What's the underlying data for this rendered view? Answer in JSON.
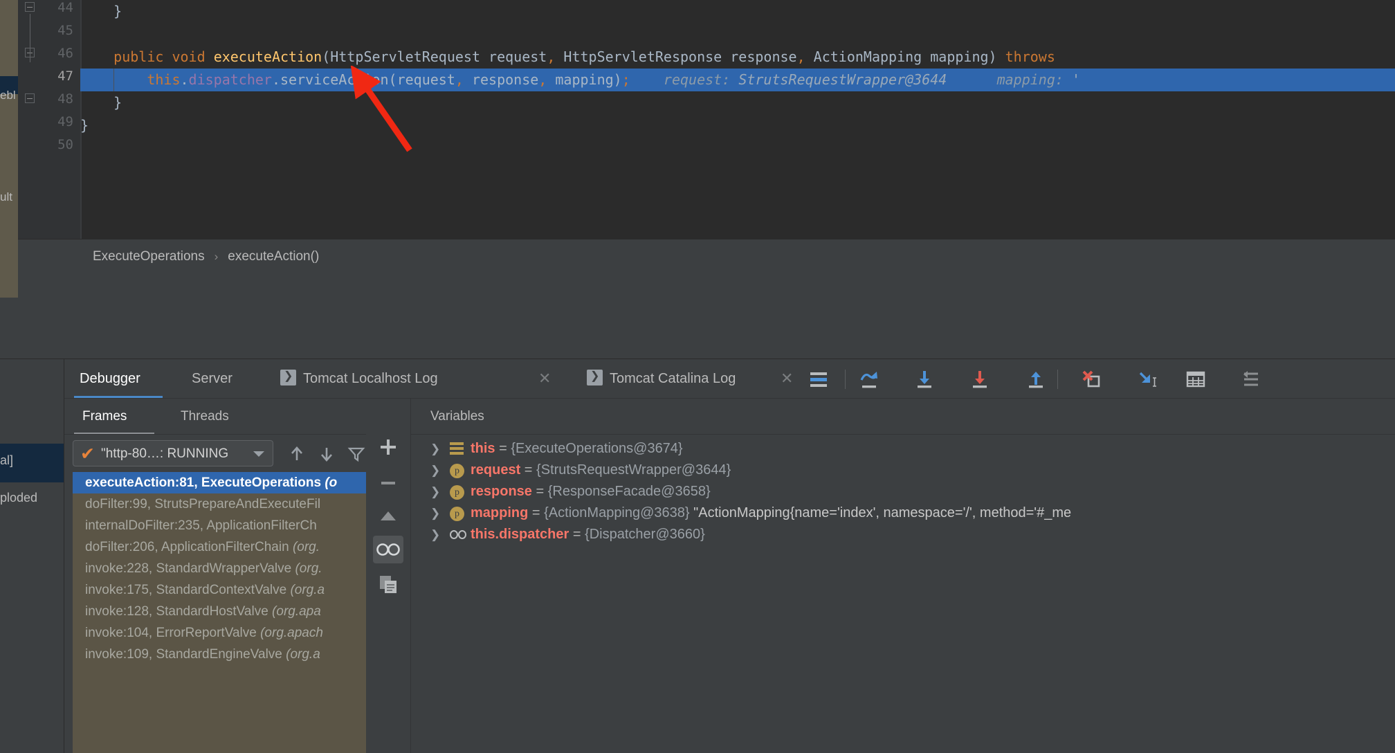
{
  "editor": {
    "gutter": {
      "line_numbers": [
        "44",
        "45",
        "46",
        "47",
        "48",
        "49",
        "50"
      ],
      "current_line": "47"
    },
    "code_lines": [
      {
        "num": "44",
        "segments": [
          {
            "t": "    }",
            "c": "pln"
          }
        ]
      },
      {
        "num": "45",
        "segments": []
      },
      {
        "num": "46",
        "segments": [
          {
            "t": "    ",
            "c": "pln"
          },
          {
            "t": "public",
            "c": "kw"
          },
          {
            "t": " ",
            "c": "pln"
          },
          {
            "t": "void",
            "c": "kw"
          },
          {
            "t": " ",
            "c": "pln"
          },
          {
            "t": "executeAction",
            "c": "mth"
          },
          {
            "t": "(HttpServletRequest request",
            "c": "pln"
          },
          {
            "t": ",",
            "c": "comma"
          },
          {
            "t": " HttpServletResponse response",
            "c": "pln"
          },
          {
            "t": ",",
            "c": "comma"
          },
          {
            "t": " ActionMapping mapping) ",
            "c": "pln"
          },
          {
            "t": "throws",
            "c": "kw"
          }
        ]
      },
      {
        "num": "47",
        "segments": [
          {
            "t": "        ",
            "c": "pln"
          },
          {
            "t": "this",
            "c": "kw"
          },
          {
            "t": ".",
            "c": "pln"
          },
          {
            "t": "dispatcher",
            "c": "fld"
          },
          {
            "t": ".serviceAction(request",
            "c": "pln"
          },
          {
            "t": ",",
            "c": "comma"
          },
          {
            "t": " response",
            "c": "pln"
          },
          {
            "t": ",",
            "c": "comma"
          },
          {
            "t": " mapping)",
            "c": "pln"
          },
          {
            "t": ";",
            "c": "comma"
          },
          {
            "t": "    request: ",
            "c": "hint"
          },
          {
            "t": "StrutsRequestWrapper@3644",
            "c": "hintv"
          },
          {
            "t": "      mapping: ",
            "c": "hint"
          },
          {
            "t": "'",
            "c": "hintv"
          }
        ]
      },
      {
        "num": "48",
        "segments": [
          {
            "t": "    }",
            "c": "pln"
          }
        ]
      },
      {
        "num": "49",
        "segments": [
          {
            "t": "}",
            "c": "pln"
          }
        ]
      },
      {
        "num": "50",
        "segments": []
      }
    ],
    "left_strip_labels": {
      "top": "ebl",
      "bottom": "ult"
    },
    "breadcrumb": {
      "class_name": "ExecuteOperations",
      "separator": "›",
      "method_name": "executeAction()"
    }
  },
  "debug_rail": {
    "label_a": "al]",
    "label_b": "ploded"
  },
  "debug_tabs": [
    {
      "label": "Debugger",
      "active": true,
      "icon": null,
      "closable": false
    },
    {
      "label": "Server",
      "active": false,
      "icon": null,
      "closable": false
    },
    {
      "label": "Tomcat Localhost Log",
      "active": false,
      "icon": "run-icon",
      "closable": true
    },
    {
      "label": "Tomcat Catalina Log",
      "active": false,
      "icon": "run-icon",
      "closable": true
    }
  ],
  "debug_toolbar": [
    {
      "name": "show-execution-point-icon",
      "title": "Show Execution Point"
    },
    {
      "name": "step-over-icon",
      "title": "Step Over"
    },
    {
      "name": "step-into-icon",
      "title": "Step Into"
    },
    {
      "name": "force-step-into-icon",
      "title": "Force Step Into"
    },
    {
      "name": "step-out-icon",
      "title": "Step Out"
    },
    {
      "name": "drop-frame-icon",
      "title": "Drop Frame"
    },
    {
      "name": "run-to-cursor-icon",
      "title": "Run to Cursor"
    },
    {
      "name": "evaluate-expression-icon",
      "title": "Evaluate Expression"
    },
    {
      "name": "settings-lines-icon",
      "title": "Layout Settings"
    }
  ],
  "frames_panel": {
    "tabs": [
      {
        "label": "Frames",
        "active": true
      },
      {
        "label": "Threads",
        "active": false
      }
    ],
    "thread_selector": {
      "value": "\"http-80…: RUNNING",
      "status_icon": "check-icon"
    },
    "thread_buttons": [
      {
        "name": "move-up-icon"
      },
      {
        "name": "move-down-icon"
      },
      {
        "name": "filter-icon"
      }
    ],
    "frames": [
      {
        "method": "executeAction:81, ExecuteOperations ",
        "pkg": "(o",
        "selected": true
      },
      {
        "method": "doFilter:99, StrutsPrepareAndExecuteFil",
        "pkg": "",
        "selected": false
      },
      {
        "method": "internalDoFilter:235, ApplicationFilterCh",
        "pkg": "",
        "selected": false
      },
      {
        "method": "doFilter:206, ApplicationFilterChain ",
        "pkg": "(org.",
        "selected": false
      },
      {
        "method": "invoke:228, StandardWrapperValve ",
        "pkg": "(org.",
        "selected": false
      },
      {
        "method": "invoke:175, StandardContextValve ",
        "pkg": "(org.a",
        "selected": false
      },
      {
        "method": "invoke:128, StandardHostValve ",
        "pkg": "(org.apa",
        "selected": false
      },
      {
        "method": "invoke:104, ErrorReportValve ",
        "pkg": "(org.apach",
        "selected": false
      },
      {
        "method": "invoke:109, StandardEngineValve ",
        "pkg": "(org.a",
        "selected": false
      }
    ]
  },
  "mini_toolbar": [
    {
      "name": "add-watch-icon",
      "glyph": "+"
    },
    {
      "name": "remove-watch-icon",
      "glyph": "−"
    },
    {
      "name": "move-watch-up-icon",
      "glyph": "▲"
    },
    {
      "name": "move-watch-down-icon",
      "glyph": "▼"
    },
    {
      "name": "copy-value-icon",
      "glyph": "⧉"
    },
    {
      "name": "watches-toggle-icon",
      "glyph": "oo"
    }
  ],
  "variables_panel": {
    "header": "Variables",
    "rows": [
      {
        "icon": "field-icon",
        "name": "this",
        "eq": " = ",
        "value": "{ExecuteOperations@3674}",
        "string": ""
      },
      {
        "icon": "param-icon",
        "name": "request",
        "eq": " = ",
        "value": "{StrutsRequestWrapper@3644}",
        "string": ""
      },
      {
        "icon": "param-icon",
        "name": "response",
        "eq": " = ",
        "value": "{ResponseFacade@3658}",
        "string": ""
      },
      {
        "icon": "param-icon",
        "name": "mapping",
        "eq": " = ",
        "value": "{ActionMapping@3638}",
        "string": " \"ActionMapping{name='index', namespace='/', method='#_me"
      },
      {
        "icon": "watch-icon",
        "name": "this.dispatcher",
        "eq": " = ",
        "value": "{Dispatcher@3660}",
        "string": ""
      }
    ]
  },
  "annotation": {
    "type": "arrow",
    "color": "#f02813"
  },
  "colors": {
    "editor_bg": "#2b2b2b",
    "panel_bg": "#3c3f41",
    "highlight_blue": "#2f66ad",
    "frames_bg": "#5b5546",
    "accent_orange": "#cc7832",
    "var_name_red": "#f77669",
    "icon_gold": "#b89a4d"
  }
}
